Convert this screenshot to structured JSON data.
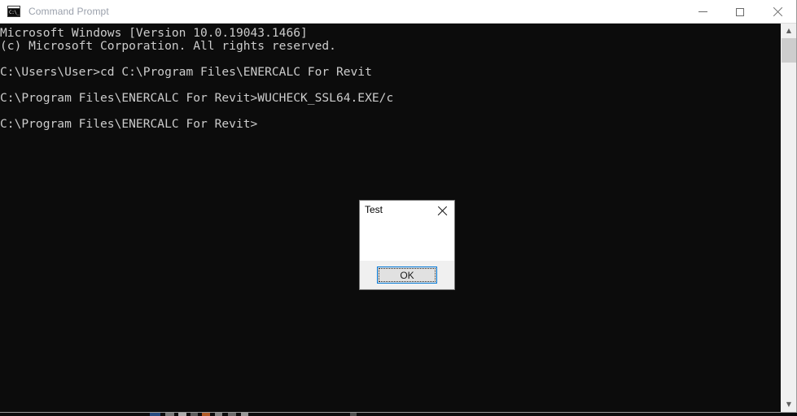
{
  "window": {
    "title": "Command Prompt",
    "icon": "command-prompt-icon",
    "icon_text": "C:\\_",
    "controls": {
      "minimize": "minimize-icon",
      "maximize": "maximize-icon",
      "close": "close-icon"
    }
  },
  "console": {
    "background": "#0c0c0c",
    "foreground": "#cccccc",
    "lines": [
      "Microsoft Windows [Version 10.0.19043.1466]",
      "(c) Microsoft Corporation. All rights reserved.",
      "",
      "C:\\Users\\User>cd C:\\Program Files\\ENERCALC For Revit",
      "",
      "C:\\Program Files\\ENERCALC For Revit>WUCHECK_SSL64.EXE/c",
      "",
      "C:\\Program Files\\ENERCALC For Revit>"
    ],
    "text": "Microsoft Windows [Version 10.0.19043.1466]\n(c) Microsoft Corporation. All rights reserved.\n\nC:\\Users\\User>cd C:\\Program Files\\ENERCALC For Revit\n\nC:\\Program Files\\ENERCALC For Revit>WUCHECK_SSL64.EXE/c\n\nC:\\Program Files\\ENERCALC For Revit>",
    "scrollbar": {
      "up_arrow": "▲",
      "down_arrow": "▼"
    }
  },
  "dialog": {
    "title": "Test",
    "message": "",
    "close_icon": "close-icon",
    "ok_label": "OK",
    "accent_color": "#0078d7"
  }
}
